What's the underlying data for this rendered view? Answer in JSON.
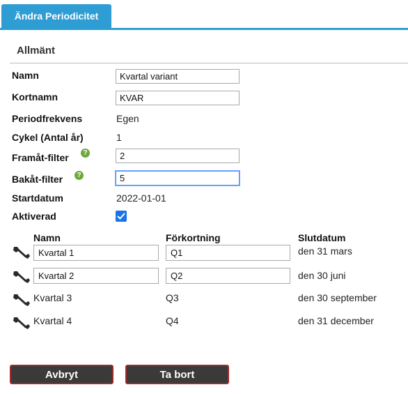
{
  "tab": {
    "label": "Ändra Periodicitet"
  },
  "section": {
    "title": "Allmänt"
  },
  "form": {
    "name_label": "Namn",
    "name_value": "Kvartal variant",
    "shortname_label": "Kortnamn",
    "shortname_value": "KVAR",
    "frequency_label": "Periodfrekvens",
    "frequency_value": "Egen",
    "cycle_label": "Cykel (Antal år)",
    "cycle_value": "1",
    "forward_label": "Framåt-filter",
    "forward_value": "2",
    "backward_label": "Bakåt-filter",
    "backward_value": "5",
    "startdate_label": "Startdatum",
    "startdate_value": "2022-01-01",
    "activated_label": "Aktiverad",
    "activated": true,
    "help_glyph": "?"
  },
  "periods": {
    "headers": {
      "name": "Namn",
      "abbr": "Förkortning",
      "end": "Slutdatum"
    },
    "rows": [
      {
        "name": "Kvartal 1",
        "abbr": "Q1",
        "end": "den 31 mars",
        "editable": true
      },
      {
        "name": "Kvartal 2",
        "abbr": "Q2",
        "end": "den 30 juni",
        "editable": true
      },
      {
        "name": "Kvartal 3",
        "abbr": "Q3",
        "end": "den 30 september",
        "editable": false
      },
      {
        "name": "Kvartal 4",
        "abbr": "Q4",
        "end": "den 31 december",
        "editable": false
      }
    ]
  },
  "buttons": {
    "cancel": "Avbryt",
    "delete": "Ta bort"
  },
  "colors": {
    "accent": "#2e9dd3",
    "help": "#6fa83a",
    "button_bg": "#3a3a3a",
    "button_border": "#a32a2a",
    "checkbox": "#1a73e8"
  },
  "icons": {
    "row_icon": "wrench-icon",
    "help_icon": "help-icon",
    "check_icon": "checkmark-icon"
  }
}
